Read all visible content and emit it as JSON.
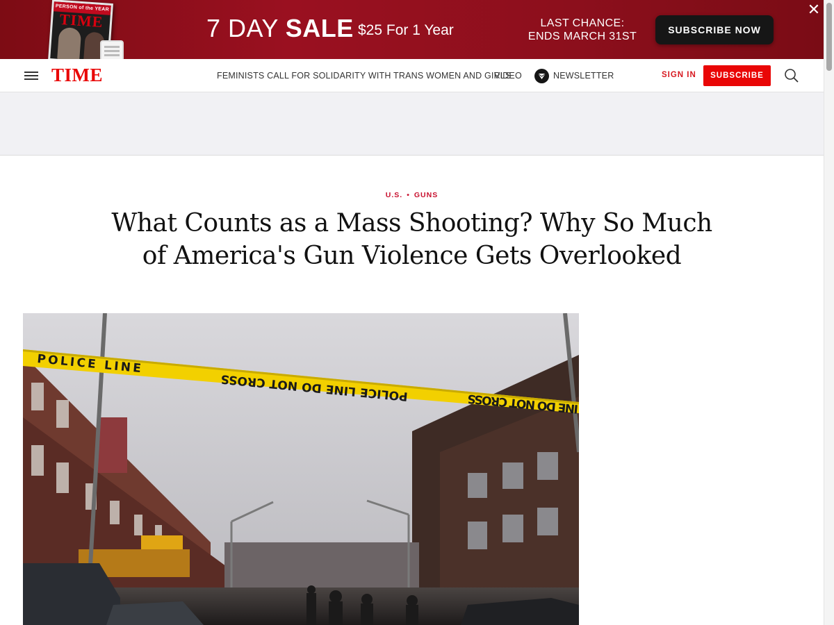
{
  "promo": {
    "cover_strip": "PERSON of the YEAR",
    "cover_masthead": "TIME",
    "title_light": "7 DAY",
    "title_bold": "SALE",
    "price": "$25 For 1 Year",
    "deadline_line1": "LAST CHANCE:",
    "deadline_line2": "ENDS MARCH 31ST",
    "cta": "SUBSCRIBE NOW",
    "close_icon": "close-icon"
  },
  "nav": {
    "logo": "TIME",
    "links": [
      "FEMINISTS CALL FOR SOLIDARITY WITH TRANS WOMEN AND GIRLS",
      "VIDEO",
      "NEWSLETTER"
    ],
    "sign_in": "SIGN IN",
    "subscribe": "SUBSCRIBE",
    "icons": [
      "menu-icon",
      "newsletter-icon",
      "search-icon"
    ]
  },
  "article": {
    "sections": [
      "U.S.",
      "GUNS"
    ],
    "headline_line1": "What Counts as a Mass Shooting? Why So Much",
    "headline_line2": "of America's Gun Violence Gets Overlooked",
    "hero_tape_text": "POLICE LINE DO NOT CROSS"
  },
  "colors": {
    "brand_red": "#e90606",
    "kicker_red": "#c8102e",
    "promo_bg": "#8c0f1c",
    "tape_yellow": "#f2d000"
  }
}
